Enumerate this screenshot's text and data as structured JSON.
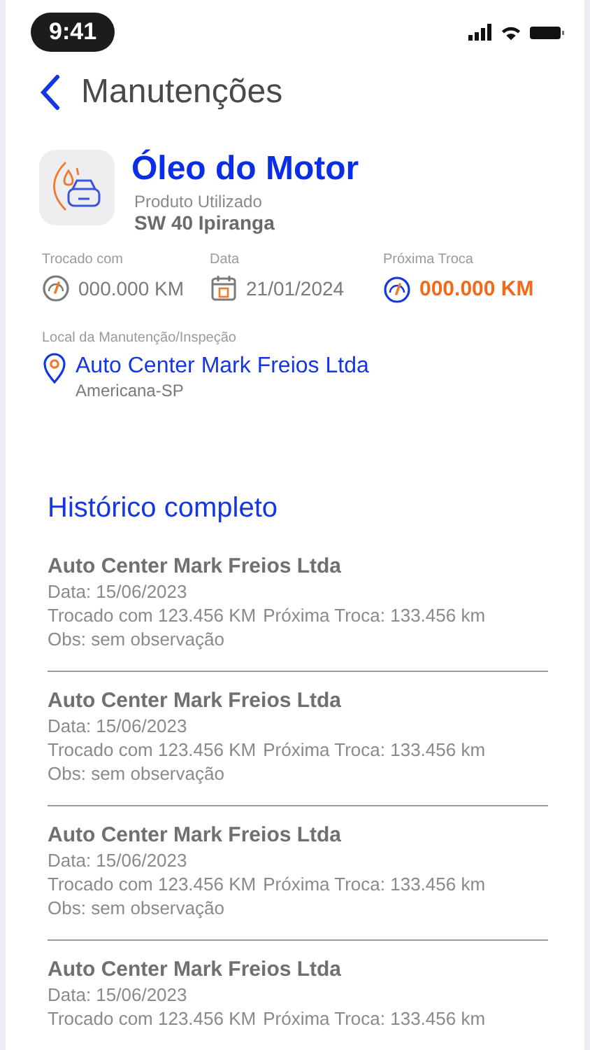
{
  "status_bar": {
    "time": "9:41"
  },
  "header": {
    "title": "Manutenções"
  },
  "service": {
    "title": "Óleo do Motor",
    "product_label": "Produto Utilizado",
    "product": "SW 40 Ipiranga",
    "stats": [
      {
        "kind": "gauge",
        "label": "Trocado com",
        "value": "000.000 KM",
        "highlight": false
      },
      {
        "kind": "calendar",
        "label": "Data",
        "value": "21/01/2024",
        "highlight": false
      },
      {
        "kind": "gauge",
        "label": "Próxima Troca",
        "value": "000.000 KM",
        "highlight": true
      }
    ],
    "location_label": "Local da Manutenção/Inspeção",
    "location": "Auto Center Mark Freios Ltda",
    "city": "Americana-SP"
  },
  "history": {
    "title": "Histórico completo",
    "items": [
      {
        "place": "Auto Center Mark Freios Ltda",
        "date": "Data: 15/06/2023",
        "changed": "Trocado com 123.456 KM",
        "next": "Próxima Troca: 133.456 km",
        "obs": "Obs: sem observação"
      },
      {
        "place": "Auto Center Mark Freios Ltda",
        "date": "Data: 15/06/2023",
        "changed": "Trocado com 123.456 KM",
        "next": "Próxima Troca: 133.456 km",
        "obs": "Obs: sem observação"
      },
      {
        "place": "Auto Center Mark Freios Ltda",
        "date": "Data: 15/06/2023",
        "changed": "Trocado com 123.456 KM",
        "next": "Próxima Troca: 133.456 km",
        "obs": "Obs: sem observação"
      },
      {
        "place": "Auto Center Mark Freios Ltda",
        "date": "Data: 15/06/2023",
        "changed": "Trocado com 123.456 KM",
        "next": "Próxima Troca: 133.456 km"
      }
    ]
  }
}
